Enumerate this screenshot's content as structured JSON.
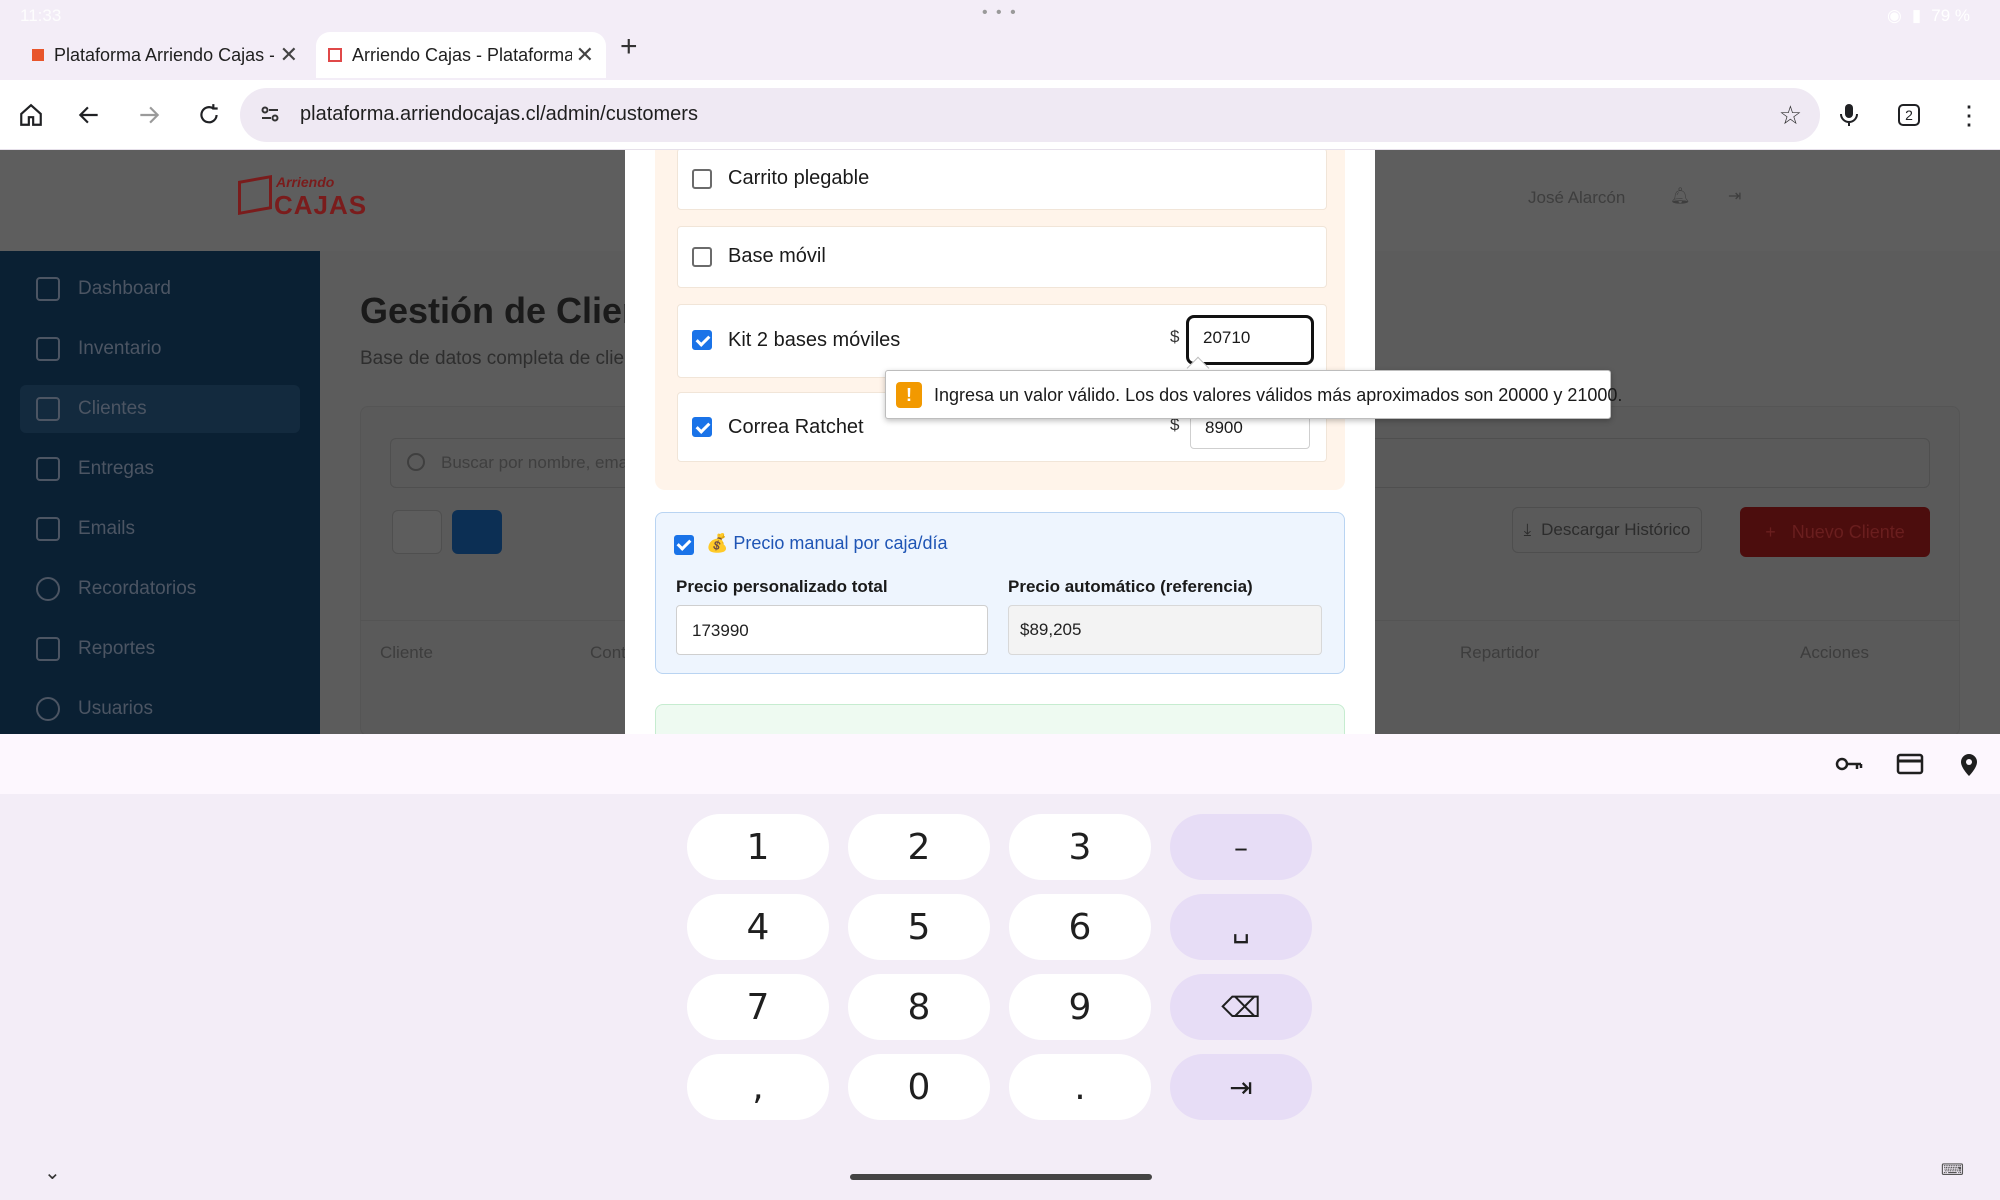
{
  "status": {
    "time": "11:33",
    "battery": "79 %"
  },
  "tabs": [
    {
      "title": "Plataforma Arriendo Cajas - I"
    },
    {
      "title": "Arriendo Cajas - Plataforma"
    }
  ],
  "browser": {
    "url": "plataforma.arriendocajas.cl/admin/customers",
    "tab_count": "2"
  },
  "app": {
    "logo_line1": "Arriendo",
    "logo_line2": "CAJAS",
    "user_name": "José Alarcón",
    "sidebar": [
      {
        "label": "Dashboard",
        "icon": "dashboard-icon"
      },
      {
        "label": "Inventario",
        "icon": "box-icon"
      },
      {
        "label": "Clientes",
        "icon": "users-icon",
        "active": true
      },
      {
        "label": "Entregas",
        "icon": "truck-icon"
      },
      {
        "label": "Emails",
        "icon": "mail-icon"
      },
      {
        "label": "Recordatorios",
        "icon": "clock-icon"
      },
      {
        "label": "Reportes",
        "icon": "chart-icon"
      },
      {
        "label": "Usuarios",
        "icon": "user-cog-icon"
      }
    ],
    "page_title": "Gestión de Clientes",
    "page_subtitle": "Base de datos completa de clientes",
    "search_placeholder": "Buscar por nombre, email...",
    "download_label": "Descargar Histórico",
    "new_label": "Nuevo Cliente",
    "table_headers": [
      "Cliente",
      "Contacto",
      "Repartidor",
      "Acciones"
    ]
  },
  "modal": {
    "accessories": [
      {
        "label": "Carrito plegable",
        "checked": false
      },
      {
        "label": "Base móvil",
        "checked": false
      },
      {
        "label": "Kit 2 bases móviles",
        "checked": true,
        "currency": "$",
        "price": "20710"
      },
      {
        "label": "Correa Ratchet",
        "checked": true,
        "currency": "$",
        "price": "8900"
      }
    ],
    "manual_price": {
      "title": "💰 Precio manual por caja/día",
      "custom_label": "Precio personalizado total",
      "custom_value": "173990",
      "auto_label": "Precio automático (referencia)",
      "auto_value": "$89,205"
    }
  },
  "tooltip": {
    "message": "Ingresa un valor válido. Los dos valores válidos más aproximados son 20000 y 21000."
  },
  "keyboard": {
    "rows": [
      [
        "1",
        "2",
        "3",
        "–"
      ],
      [
        "4",
        "5",
        "6",
        "␣"
      ],
      [
        "7",
        "8",
        "9",
        "⌫"
      ],
      [
        ",",
        "0",
        ".",
        "⇥"
      ]
    ]
  }
}
